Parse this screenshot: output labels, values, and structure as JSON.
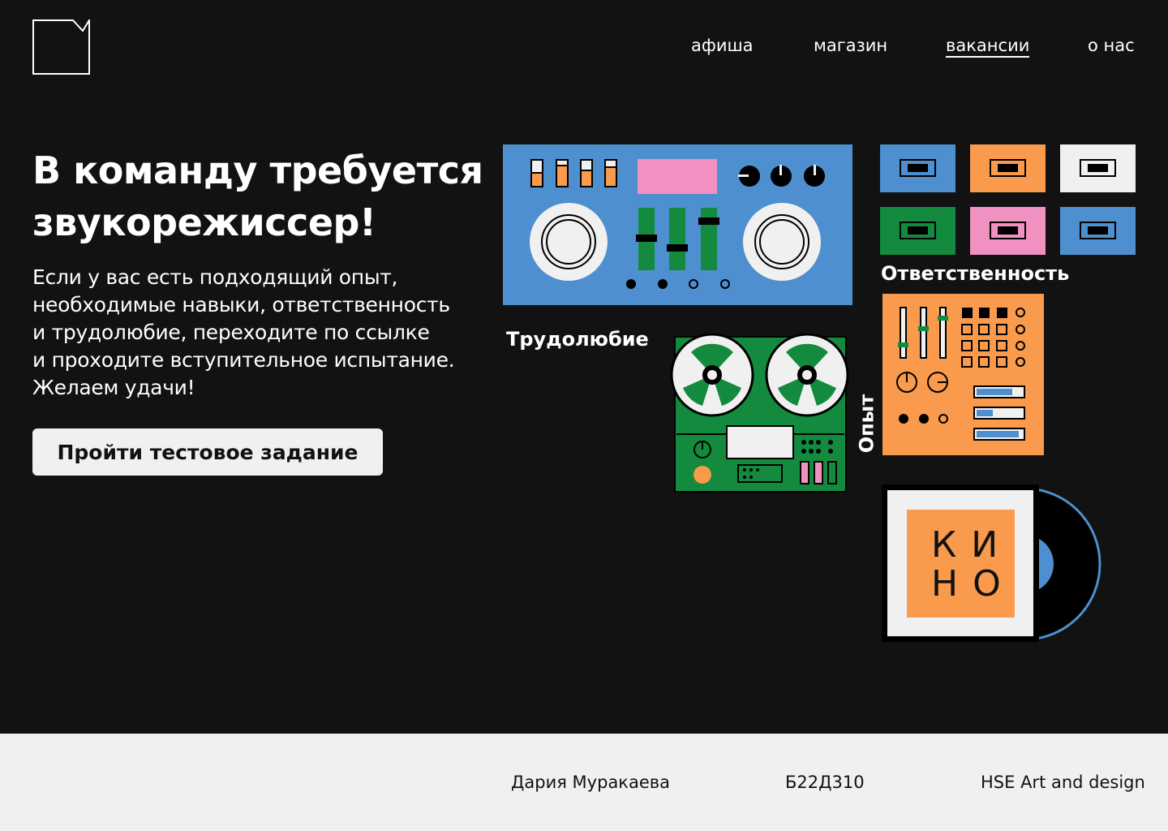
{
  "nav": {
    "items": [
      {
        "label": "афиша",
        "active": false
      },
      {
        "label": "магазин",
        "active": false
      },
      {
        "label": "вакансии",
        "active": true
      },
      {
        "label": "о нас",
        "active": false
      }
    ]
  },
  "hero": {
    "title_line1": "В команду требуется",
    "title_line2": "звукорежиссер!",
    "text_lines": [
      "Если у вас есть подходящий опыт,",
      "необходимые навыки, ответственность",
      "и трудолюбие, переходите по ссылке",
      "и проходите вступительное испытание.",
      "Желаем удачи!"
    ],
    "button_label": "Пройти тестовое задание"
  },
  "illustration": {
    "labels": {
      "hard_work": "Трудолюбие",
      "responsibility": "Ответственность",
      "experience": "Опыт"
    },
    "album_letters": [
      "К",
      "И",
      "Н",
      "О"
    ]
  },
  "footer": {
    "author": "Дария Муракаева",
    "group": "Б22Д310",
    "school": "HSE Art and design"
  },
  "colors": {
    "background": "#121212",
    "blue": "#4e8fcf",
    "orange": "#f99a4c",
    "green": "#138a3e",
    "pink": "#f191c1",
    "light": "#f0f0f0"
  }
}
